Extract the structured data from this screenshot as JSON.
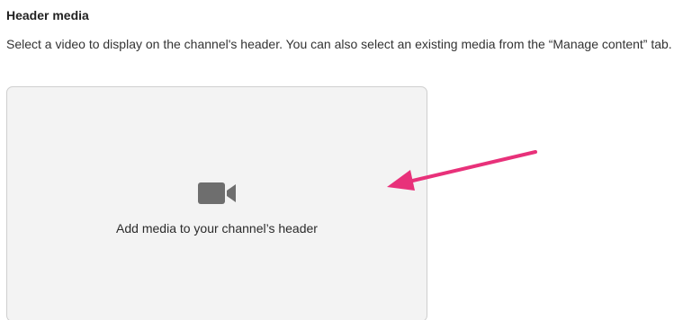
{
  "header_media": {
    "title": "Header media",
    "description": "Select a video to display on the channel's header. You can also select an existing media from the “Manage content” tab.",
    "dropzone": {
      "label": "Add media to your channel’s header",
      "icon": "video-camera-icon"
    }
  },
  "annotation": {
    "icon": "arrow-icon",
    "color": "#e8317a"
  },
  "colors": {
    "dropzone_bg": "#f3f3f3",
    "dropzone_border": "#cfcfcf",
    "icon_gray": "#6e6e6e"
  }
}
